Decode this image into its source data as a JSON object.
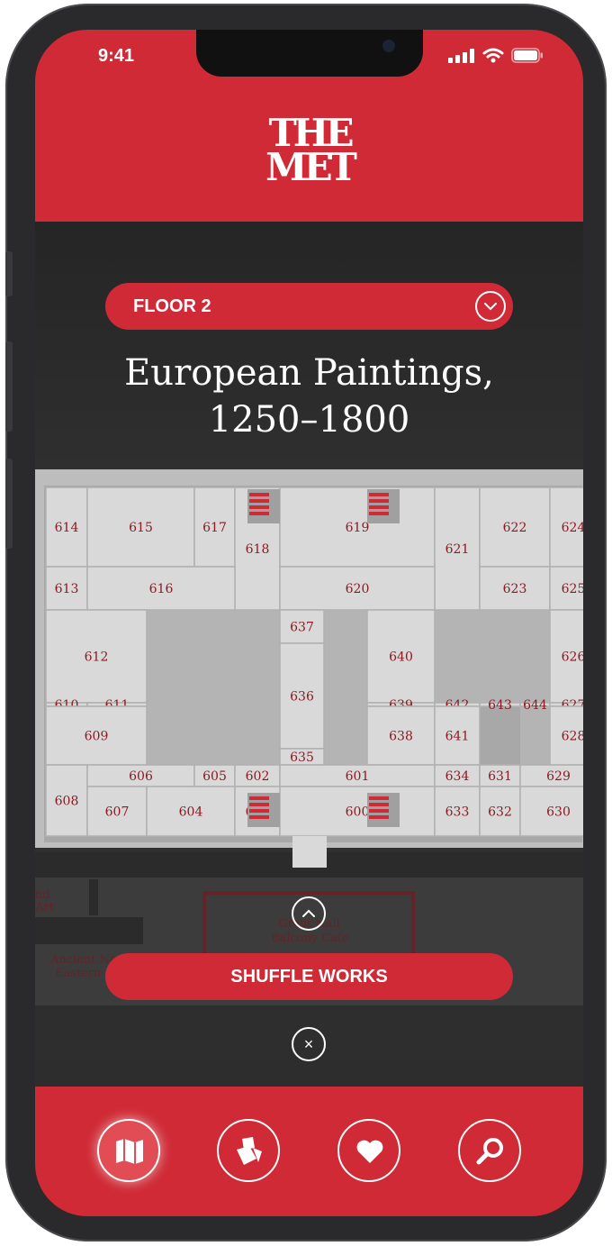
{
  "status_bar": {
    "time": "9:41"
  },
  "header": {
    "logo_line1": "THE",
    "logo_line2": "MET"
  },
  "floor_selector": {
    "label": "FLOOR 2"
  },
  "gallery": {
    "title_line1": "European Paintings,",
    "title_line2": "1250–1800"
  },
  "map": {
    "rooms": [
      "614",
      "615",
      "617",
      "618",
      "619",
      "621",
      "622",
      "624",
      "613",
      "616",
      "620",
      "623",
      "625",
      "612",
      "637",
      "640",
      "626",
      "610",
      "611",
      "636",
      "639",
      "642",
      "643",
      "644",
      "627",
      "609",
      "635",
      "638",
      "641",
      "628",
      "608",
      "606",
      "605",
      "602",
      "601",
      "634",
      "631",
      "629",
      "607",
      "604",
      "603",
      "600",
      "633",
      "632",
      "630"
    ],
    "background_labels": [
      "Great Hall",
      "Balcony Cafe",
      "Ancient Near",
      "Eastern",
      "nd",
      "Art"
    ]
  },
  "actions": {
    "shuffle_label": "SHUFFLE WORKS",
    "close_symbol": "×"
  },
  "nav": [
    {
      "name": "map-icon",
      "active": true
    },
    {
      "name": "artworks-icon",
      "active": false
    },
    {
      "name": "favorites-icon",
      "active": false
    },
    {
      "name": "search-icon",
      "active": false
    }
  ],
  "colors": {
    "brand_red": "#cf2a35",
    "room_fill": "#d9d9d9",
    "room_text": "#8b1a22",
    "dark_bg": "#2f2f2f"
  }
}
